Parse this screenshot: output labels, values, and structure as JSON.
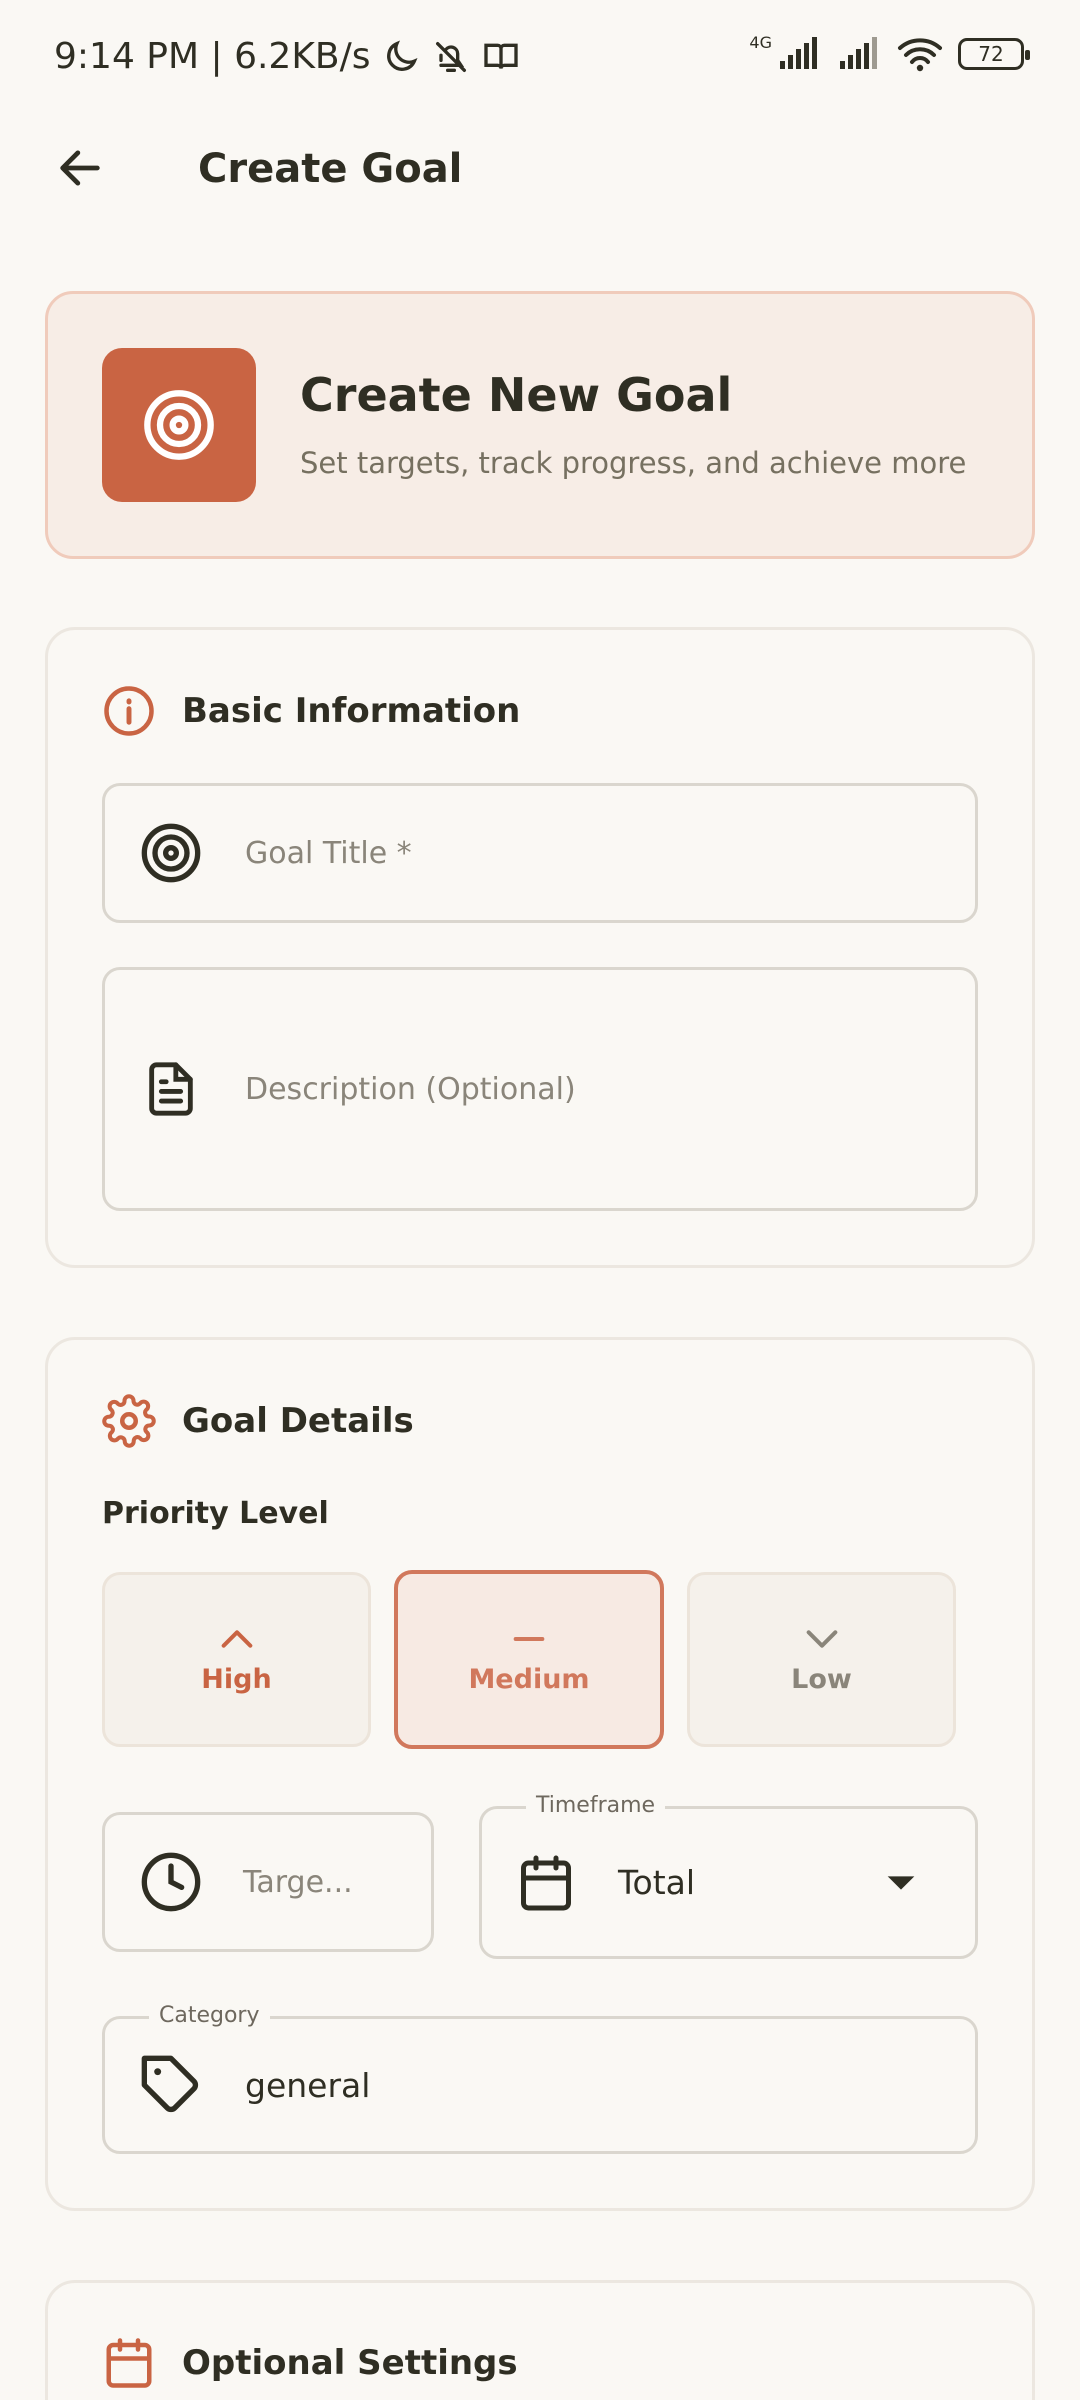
{
  "status_bar": {
    "time_speed": "9:14 PM | 6.2KB/s",
    "network_type": "4G",
    "battery": "72",
    "icons": [
      "moon-icon",
      "bell-off-icon",
      "book-icon",
      "signal-icon",
      "signal-icon",
      "wifi-icon",
      "battery-icon"
    ]
  },
  "header": {
    "title": "Create Goal",
    "back_icon": "arrow-left-icon"
  },
  "hero": {
    "title": "Create New Goal",
    "subtitle": "Set targets, track progress, and achieve more",
    "icon": "target-icon"
  },
  "basic_info": {
    "title": "Basic Information",
    "icon": "info-icon",
    "goal_title_placeholder": "Goal Title *",
    "description_placeholder": "Description (Optional)"
  },
  "goal_details": {
    "title": "Goal Details",
    "icon": "gear-icon",
    "priority_label": "Priority Level",
    "priorities": [
      {
        "label": "High",
        "icon": "chevron-up-icon",
        "selected": false
      },
      {
        "label": "Medium",
        "icon": "minus-icon",
        "selected": true
      },
      {
        "label": "Low",
        "icon": "chevron-down-icon",
        "selected": false
      }
    ],
    "target_placeholder": "Targe...",
    "timeframe_label": "Timeframe",
    "timeframe_value": "Total",
    "category_label": "Category",
    "category_value": "general"
  },
  "optional_settings": {
    "title": "Optional Settings",
    "icon": "calendar-icon"
  },
  "colors": {
    "accent": "#C96443",
    "background": "#FAF8F4",
    "text": "#2F2E23"
  }
}
